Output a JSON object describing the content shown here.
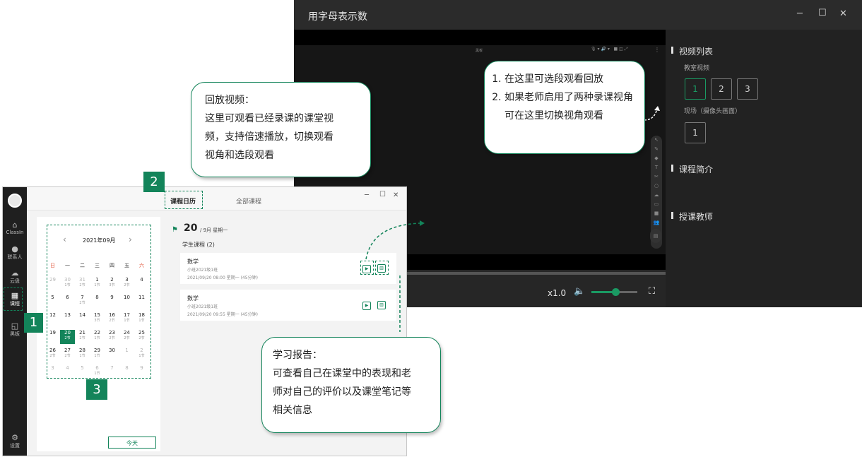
{
  "player": {
    "title": "用字母表示数",
    "minimize": "─",
    "maximize": "☐",
    "close": "✕",
    "video_label": "黑板",
    "speed": "x1.0",
    "sidebar": {
      "video_list": "视频列表",
      "classroom_video": "教室视频",
      "classroom_segments": [
        "1",
        "2",
        "3"
      ],
      "scene_video": "现场（摄像头画面）",
      "scene_segments": [
        "1"
      ],
      "course_intro": "课程简介",
      "teacher": "授课教师"
    }
  },
  "classin": {
    "tabs": [
      "课程日历",
      "全部课程"
    ],
    "nav": [
      {
        "icon": "home-icon",
        "label": "ClassIn"
      },
      {
        "icon": "contacts-icon",
        "label": "联系人"
      },
      {
        "icon": "cloud-icon",
        "label": "云盘"
      },
      {
        "icon": "calendar-icon",
        "label": "课程"
      },
      {
        "icon": "blackboard-icon",
        "label": "黑板"
      },
      {
        "icon": "settings-icon",
        "label": "设置"
      }
    ],
    "calendar": {
      "month": "2021年09月",
      "prev": "‹",
      "next": "›",
      "weekdays": [
        "日",
        "一",
        "二",
        "三",
        "四",
        "五",
        "六"
      ],
      "weeks": [
        [
          {
            "d": "29",
            "g": true
          },
          {
            "d": "30",
            "l": "1节",
            "g": true
          },
          {
            "d": "31",
            "l": "2节",
            "g": true
          },
          {
            "d": "1",
            "l": "1节"
          },
          {
            "d": "2",
            "l": "3节"
          },
          {
            "d": "3",
            "l": "2节"
          },
          {
            "d": "4"
          }
        ],
        [
          {
            "d": "5"
          },
          {
            "d": "6"
          },
          {
            "d": "7",
            "l": "2节"
          },
          {
            "d": "8"
          },
          {
            "d": "9"
          },
          {
            "d": "10"
          },
          {
            "d": "11"
          }
        ],
        [
          {
            "d": "12"
          },
          {
            "d": "13"
          },
          {
            "d": "14"
          },
          {
            "d": "15",
            "l": "3节"
          },
          {
            "d": "16",
            "l": "2节"
          },
          {
            "d": "17",
            "l": "1节"
          },
          {
            "d": "18",
            "l": "1节"
          }
        ],
        [
          {
            "d": "19"
          },
          {
            "d": "20",
            "l": "2节",
            "s": true
          },
          {
            "d": "21",
            "l": "2节"
          },
          {
            "d": "22",
            "l": "1节"
          },
          {
            "d": "23",
            "l": "2节"
          },
          {
            "d": "24",
            "l": "2节"
          },
          {
            "d": "25",
            "l": "2节"
          }
        ],
        [
          {
            "d": "26",
            "l": "2节"
          },
          {
            "d": "27",
            "l": "2节"
          },
          {
            "d": "28",
            "l": "1节"
          },
          {
            "d": "29",
            "l": "1节"
          },
          {
            "d": "30"
          },
          {
            "d": "1",
            "g": true
          },
          {
            "d": "2",
            "l": "1节",
            "g": true
          }
        ],
        [
          {
            "d": "3",
            "g": true
          },
          {
            "d": "4",
            "g": true
          },
          {
            "d": "5",
            "g": true
          },
          {
            "d": "6",
            "l": "1节",
            "g": true
          },
          {
            "d": "7",
            "g": true
          },
          {
            "d": "8",
            "g": true
          },
          {
            "d": "9",
            "g": true
          }
        ]
      ],
      "today": "今天"
    },
    "day": {
      "date": "20",
      "month_weekday": "/ 9月 星期一",
      "section": "学生课程 (2)",
      "courses": [
        {
          "title": "数学",
          "class": "小班2021级1班",
          "time": "2021/09/20 08:00 星期一 (45分钟)"
        },
        {
          "title": "数学",
          "class": "小班2021级1班",
          "time": "2021/09/20 09:55 星期一 (45分钟)"
        }
      ]
    }
  },
  "annotations": {
    "replay": [
      "回放视频：",
      "这里可观看已经录课的课堂视",
      "频，支持倍速播放，切换观看",
      "视角和选段观看"
    ],
    "tips": [
      "在这里可选段观看回放",
      "如果老师启用了两种录课视角可在这里切换视角观看"
    ],
    "report": [
      "学习报告：",
      "可查看自己在课堂中的表现和老",
      "师对自己的评价以及课堂笔记等",
      "相关信息"
    ],
    "badges": [
      "1",
      "2",
      "3"
    ]
  },
  "colors": {
    "accent": "#13845a",
    "player_bg": "#262626"
  }
}
